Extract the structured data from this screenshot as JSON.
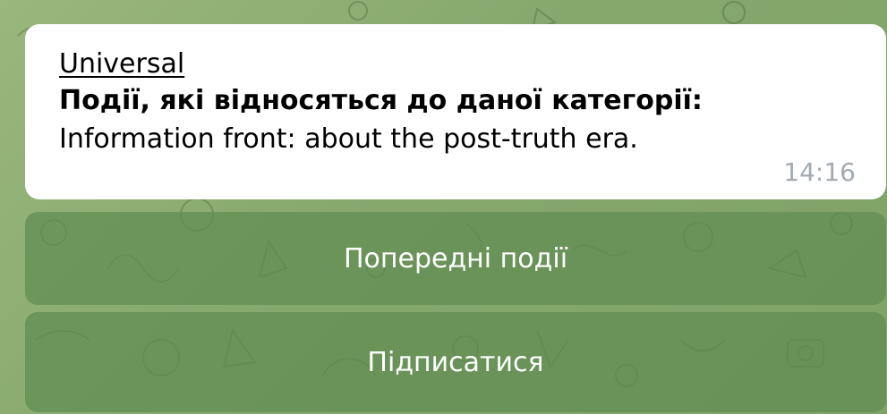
{
  "message": {
    "sender": "Universal",
    "heading": "Події, які відносяться до даної категорії:",
    "body": "Information front: about the post-truth era.",
    "time": "14:16"
  },
  "buttons": {
    "previous_events": "Попередні події",
    "subscribe": "Підписатися"
  },
  "colors": {
    "chat_background": "#8bab73",
    "bubble": "#ffffff",
    "button": "#5f8a50",
    "timestamp": "#a3aab0"
  }
}
